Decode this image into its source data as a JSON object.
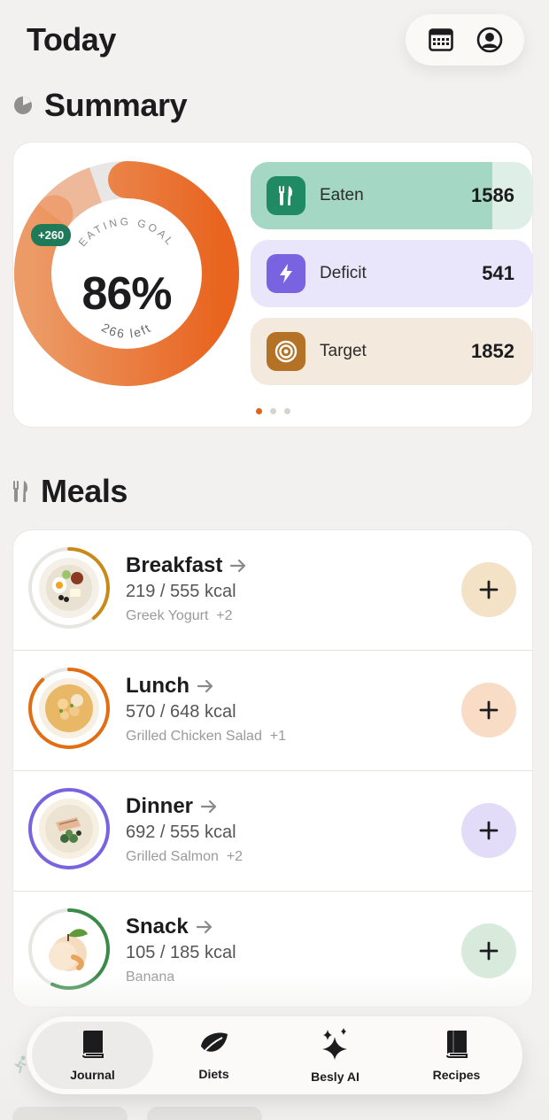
{
  "header": {
    "title": "Today"
  },
  "summary": {
    "title": "Summary",
    "ring": {
      "percent_label": "86%",
      "percent": 86,
      "top_caption": "EATING GOAL",
      "bottom_caption": "266 left",
      "over_badge": "+260"
    },
    "stats": [
      {
        "label": "Eaten",
        "value": "1586",
        "icon": "fork-knife-icon",
        "accent": "#1f8a63",
        "bg": "#deefe8",
        "fill": "#a5d8c4",
        "fill_fraction": 0.86
      },
      {
        "label": "Deficit",
        "value": "541",
        "icon": "bolt-icon",
        "accent": "#7a63e0",
        "bg": "#e9e5fb",
        "fill": "#e9e5fb",
        "fill_fraction": 1
      },
      {
        "label": "Target",
        "value": "1852",
        "icon": "target-icon",
        "accent": "#b37226",
        "bg": "#f3e9dd",
        "fill": "#f3e9dd",
        "fill_fraction": 1
      }
    ],
    "pager": {
      "count": 3,
      "active": 0
    }
  },
  "meals": {
    "title": "Meals",
    "items": [
      {
        "name": "Breakfast",
        "kcal": "219 / 555 kcal",
        "foods": "Greek Yogurt  +2",
        "ring_color": "#c98a1a",
        "progress": 0.39,
        "add_bg": "#f3e2c6"
      },
      {
        "name": "Lunch",
        "kcal": "570 / 648 kcal",
        "foods": "Grilled Chicken Salad  +1",
        "ring_color": "#e36d12",
        "progress": 0.88,
        "add_bg": "#f8dcc6"
      },
      {
        "name": "Dinner",
        "kcal": "692 / 555 kcal",
        "foods": "Grilled Salmon  +2",
        "ring_color": "#7a63e0",
        "progress": 1.0,
        "add_bg": "#e2dcf8"
      },
      {
        "name": "Snack",
        "kcal": "105 / 185 kcal",
        "foods": "Banana",
        "ring_color": "#3a8a4a",
        "progress": 0.57,
        "add_bg": "#d8eadc"
      }
    ]
  },
  "tabs": [
    {
      "label": "Journal",
      "icon": "book-icon",
      "active": true
    },
    {
      "label": "Diets",
      "icon": "leaf-icon",
      "active": false
    },
    {
      "label": "Besly AI",
      "icon": "sparkles-icon",
      "active": false
    },
    {
      "label": "Recipes",
      "icon": "recipe-book-icon",
      "active": false
    }
  ]
}
